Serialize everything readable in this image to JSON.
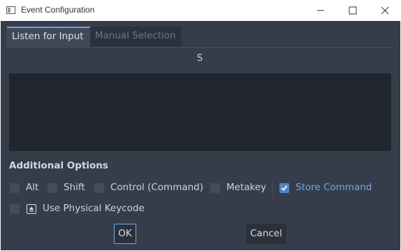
{
  "window": {
    "title": "Event Configuration",
    "controls": [
      "minimize-icon",
      "maximize-icon",
      "close-icon"
    ]
  },
  "tabs": [
    {
      "label": "Listen for Input",
      "active": true
    },
    {
      "label": "Manual Selection",
      "active": false
    }
  ],
  "listen": {
    "captured_key": "S"
  },
  "options": {
    "title": "Additional Options",
    "modifiers": [
      {
        "label": "Alt",
        "checked": false
      },
      {
        "label": "Shift",
        "checked": false
      },
      {
        "label": "Control (Command)",
        "checked": false
      },
      {
        "label": "Metakey",
        "checked": false
      },
      {
        "label": "Store Command",
        "checked": true
      }
    ],
    "physical_keycode": {
      "label": "Use Physical Keycode",
      "checked": false,
      "icon": "keyboard-key-icon"
    }
  },
  "buttons": {
    "ok": "OK",
    "cancel": "Cancel"
  },
  "colors": {
    "dialog_bg": "#363d4a",
    "panel_bg": "#21262e",
    "accent": "#6fa6e6",
    "checkbox_on": "#4d84c7"
  }
}
